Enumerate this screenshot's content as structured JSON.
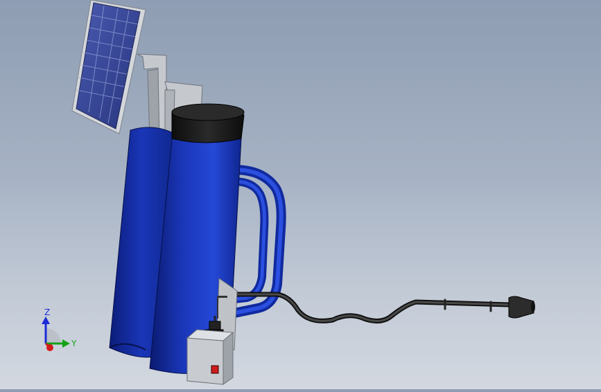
{
  "viewport": {
    "background_top": "#8e9db3",
    "background_bottom": "#d3d8e0",
    "model": {
      "tank_color": "#1a36b8",
      "tank_dark": "#0b1a66",
      "cap_color": "#161616",
      "hose_color": "#1f1f1f",
      "panel_frame": "#c9cdd2",
      "solar_cell": "#3a4a9a",
      "bracket_color": "#b8bcc2",
      "switch_color": "#cc1c1c"
    }
  },
  "triad": {
    "z_label": "Z",
    "y_label": "Y",
    "z_color": "#1c2bd8",
    "y_color": "#17a117",
    "x_color": "#d41a1a"
  }
}
